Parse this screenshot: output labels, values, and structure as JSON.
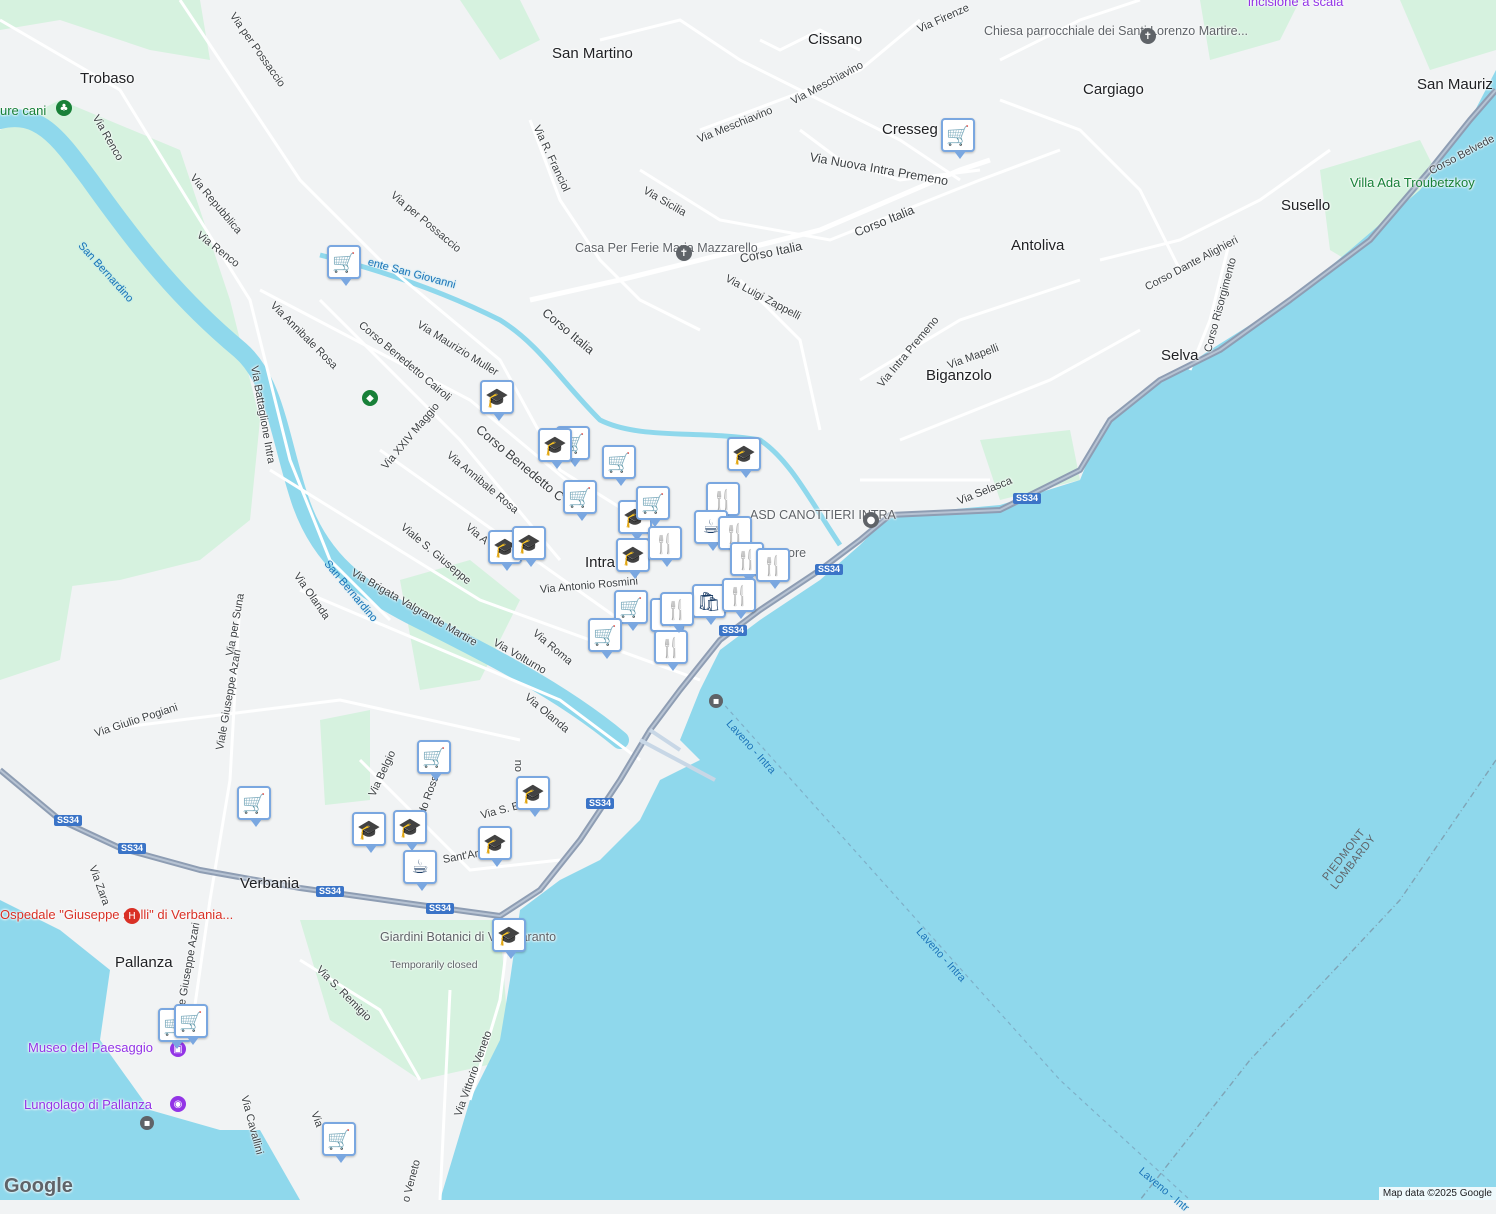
{
  "map": {
    "colors": {
      "land": "#f1f3f4",
      "water": "#8fd8ec",
      "park": "#d6f2df",
      "road": "#ffffff",
      "highway": "#8e9db3",
      "marker_border": "#7aa7e0",
      "marker_icon": "#1b3d66"
    },
    "places": {
      "trobaso": "Trobaso",
      "san_martino": "San Martino",
      "cissano": "Cissano",
      "cargiago": "Cargiago",
      "san_maurizio": "San Mauriz",
      "cresseglio": "Cresseg",
      "susello": "Susello",
      "antoliva": "Antoliva",
      "selva": "Selva",
      "biganzolo": "Biganzolo",
      "intra": "Intra",
      "verbania": "Verbania",
      "pallanza": "Pallanza"
    },
    "streets": {
      "via_per_possaccio_top": "Via per Possaccio",
      "via_per_possaccio": "Via per Possaccio",
      "via_renco_1": "Via Renco",
      "via_renco_2": "Via Renco",
      "via_repubblica": "Via Repubblica",
      "via_annibale_rosa_1": "Via Annibale Rosa",
      "via_battaglione_intra": "Via Battaglione Intra",
      "corso_benedetto_cairoli_1": "Corso Benedetto Cairoli",
      "corso_benedetto_cairoli_2": "Corso Benedetto C",
      "via_maurizio_muller": "Via Maurizio Muller",
      "via_xxiv_maggio": "Via XXIV Maggio",
      "via_annibale_rosa_2": "Via Annibale Rosa",
      "viale_s_giuseppe": "Viale S. Giuseppe",
      "via_a": "Via A",
      "via_antonio_rosmini": "Via Antonio Rosmini",
      "via_olanda_1": "Via Olanda",
      "via_brigata": "Via Brigata Valgrande Martire",
      "via_roma": "Via Roma",
      "via_volturno": "Via Volturno",
      "via_per_suna": "Via per Suna",
      "viale_giuseppe_azari": "Viale Giuseppe Azari",
      "via_giulio_pogiani": "Via Giulio Pogiani",
      "via_olanda_2": "Via Olanda",
      "via_belgio": "Via Belgio",
      "do_rossi": "do Rossi",
      "via_s_b": "Via S. B",
      "sant_an": "Sant'An",
      "via_zara": "Via Zara",
      "viale_giuseppe_azari_2": "iale Giuseppe Azari",
      "via_s_remigio": "Via S. Remigio",
      "via_vittorio_veneto": "Via Vittorio Veneto",
      "o_veneto": "o Veneto",
      "via_cavallini": "Via Cavallini",
      "via_short": "Via",
      "via_meschiavino_1": "Via Meschiavino",
      "via_meschiavino_2": "Via Meschiavino",
      "via_r_franciol": "Via R. Franciol",
      "via_sicilia": "Via Sicilia",
      "via_nuova_intra_premeno": "Via Nuova Intra Premeno",
      "corso_italia_1": "Corso Italia",
      "corso_italia_2": "Corso Italia",
      "corso_italia_3": "Corso Italia",
      "via_luigi_zappelli": "Via Luigi Zappelli",
      "via_intra_premeno": "Via Intra Premeno",
      "via_mapelli": "Via Mapelli",
      "via_selasca": "Via Selasca",
      "corso_dante_alighieri": "Corso Dante Alighieri",
      "corso_risorgimento": "Corso Risorgimento",
      "corso_belvedere": "Corso Belvede",
      "via_firenze": "Via Firenze",
      "ou": "ou"
    },
    "water_labels": {
      "san_bernardino_1": "San Bernardino",
      "san_bernardino_2": "San Bernardino",
      "torrente_san_giovanni": "ente San Giovanni",
      "laveno_intra_1": "Laveno - Intra",
      "laveno_intra_2": "Laveno - Intra",
      "laveno_intra_3": "Laveno - Intr"
    },
    "pois": {
      "chiesa": "Chiesa parrocchiale dei Santi Lorenzo Martire...",
      "casa_per_ferie": "Casa Per Ferie Maria Mazzarello",
      "villa_ada": "Villa Ada Troubetzkoy",
      "asd_canottieri": "ASD CANOTTIERI INTRA",
      "ospedale": "Ospedale \"Giuseppe stelli\" di Verbania...",
      "giardini": "Giardini Botanici di Villa Taranto",
      "giardini_status": "Temporarily closed",
      "museo": "Museo del Paesaggio",
      "lungolago": "Lungolago di Pallanza",
      "incisione": "incisione a scala",
      "ure_cani": "ure cani",
      "ore_fragment": "ore"
    },
    "highway_shields": [
      "SS34",
      "SS34",
      "SS34",
      "SS34",
      "SS34",
      "SS34",
      "SS34"
    ],
    "border_label": "PIEDMONT LOMBARDY",
    "markers": [
      {
        "type": "grocery",
        "icon": "cart"
      },
      {
        "type": "grocery",
        "icon": "cart"
      },
      {
        "type": "school",
        "icon": "cap"
      },
      {
        "type": "grocery",
        "icon": "cart"
      },
      {
        "type": "school",
        "icon": "cap"
      },
      {
        "type": "grocery",
        "icon": "cart"
      },
      {
        "type": "grocery",
        "icon": "cart"
      },
      {
        "type": "school",
        "icon": "cap"
      },
      {
        "type": "school",
        "icon": "cap"
      },
      {
        "type": "grocery",
        "icon": "cart"
      },
      {
        "type": "restaurant",
        "icon": "fork-knife"
      },
      {
        "type": "cafe",
        "icon": "cup"
      },
      {
        "type": "school",
        "icon": "cap"
      },
      {
        "type": "school",
        "icon": "cap"
      },
      {
        "type": "school",
        "icon": "cap"
      },
      {
        "type": "restaurant",
        "icon": "fork-knife"
      },
      {
        "type": "restaurant",
        "icon": "fork-knife"
      },
      {
        "type": "restaurant",
        "icon": "fork-knife"
      },
      {
        "type": "restaurant",
        "icon": "fork-knife"
      },
      {
        "type": "shopping",
        "icon": "bag"
      },
      {
        "type": "restaurant",
        "icon": "fork-knife"
      },
      {
        "type": "restaurant",
        "icon": "fork-knife"
      },
      {
        "type": "grocery",
        "icon": "cart"
      },
      {
        "type": "grocery",
        "icon": "cart"
      },
      {
        "type": "restaurant",
        "icon": "fork-knife"
      },
      {
        "type": "restaurant",
        "icon": "fork-knife"
      },
      {
        "type": "grocery",
        "icon": "cart"
      },
      {
        "type": "school",
        "icon": "cap"
      },
      {
        "type": "grocery",
        "icon": "cart"
      },
      {
        "type": "school",
        "icon": "cap"
      },
      {
        "type": "school",
        "icon": "cap"
      },
      {
        "type": "school",
        "icon": "cap"
      },
      {
        "type": "cafe",
        "icon": "cup"
      },
      {
        "type": "school",
        "icon": "cap"
      },
      {
        "type": "grocery",
        "icon": "cart"
      },
      {
        "type": "grocery",
        "icon": "cart"
      },
      {
        "type": "grocery",
        "icon": "cart"
      }
    ],
    "icon_glyphs": {
      "cart": "🛒",
      "cap": "🎓",
      "fork-knife": "🍴",
      "cup": "☕",
      "bag": "🛍"
    },
    "logo": "Google",
    "attribution": "Map data ©2025 Google"
  }
}
